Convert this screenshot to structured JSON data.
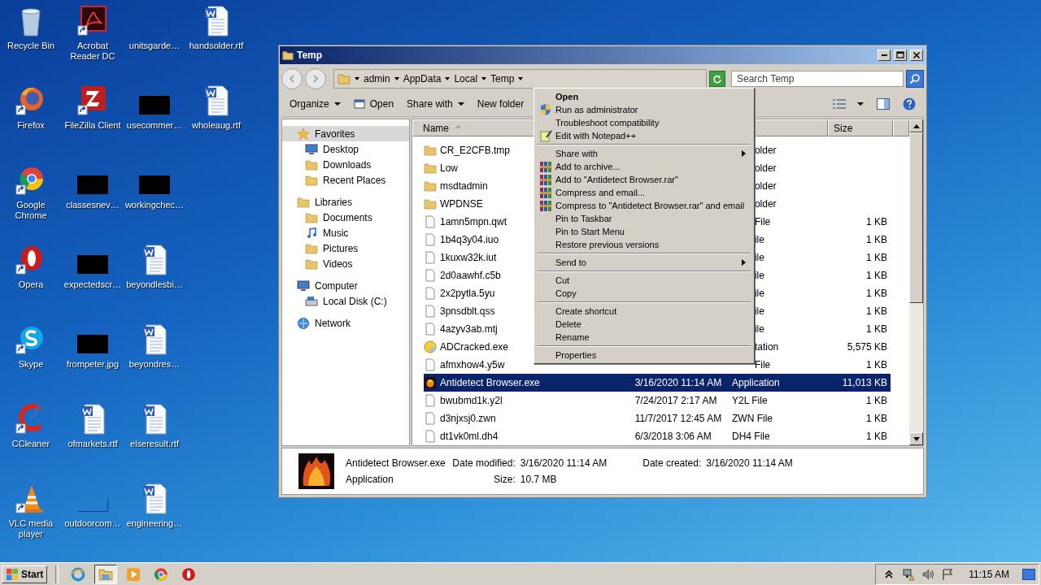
{
  "desktop": {
    "icons": [
      {
        "label": "Recycle Bin",
        "kind": "recycle",
        "shortcut": false
      },
      {
        "label": "Firefox",
        "kind": "firefox",
        "shortcut": true
      },
      {
        "label": "Google Chrome",
        "kind": "chrome",
        "shortcut": true
      },
      {
        "label": "Opera",
        "kind": "opera",
        "shortcut": true
      },
      {
        "label": "Skype",
        "kind": "skype",
        "shortcut": true
      },
      {
        "label": "CCleaner",
        "kind": "ccleaner",
        "shortcut": true
      },
      {
        "label": "VLC media player",
        "kind": "vlc",
        "shortcut": true
      },
      {
        "label": "Acrobat Reader DC",
        "kind": "acrobat",
        "shortcut": true
      },
      {
        "label": "FileZilla Client",
        "kind": "filezilla",
        "shortcut": true
      },
      {
        "label": "classesnev…",
        "kind": "dark",
        "shortcut": false
      },
      {
        "label": "expectedscr…",
        "kind": "dark",
        "shortcut": false
      },
      {
        "label": "frompeter.jpg",
        "kind": "dark",
        "shortcut": false
      },
      {
        "label": "ofmarkets.rtf",
        "kind": "word",
        "shortcut": false
      },
      {
        "label": "outdoorcom…",
        "kind": "blank",
        "shortcut": false
      },
      {
        "label": "unitsgarde…",
        "kind": "blank",
        "shortcut": false
      },
      {
        "label": "usecommer…",
        "kind": "dark",
        "shortcut": false
      },
      {
        "label": "workingchec…",
        "kind": "dark",
        "shortcut": false
      },
      {
        "label": "beyondlesbi…",
        "kind": "word",
        "shortcut": false
      },
      {
        "label": "beyondres…",
        "kind": "word",
        "shortcut": false
      },
      {
        "label": "elseresult.rtf",
        "kind": "word",
        "shortcut": false
      },
      {
        "label": "engineering…",
        "kind": "word",
        "shortcut": false
      },
      {
        "label": "handsolder.rtf",
        "kind": "word",
        "shortcut": false
      },
      {
        "label": "wholeaug.rtf",
        "kind": "word",
        "shortcut": false
      }
    ]
  },
  "window": {
    "title": "Temp",
    "address": [
      "admin",
      "AppData",
      "Local",
      "Temp"
    ],
    "search": {
      "placeholder": "Search Temp"
    },
    "toolbar": [
      {
        "label": "Organize",
        "kind": "text",
        "dropdown": true
      },
      {
        "label": "Open",
        "kind": "open",
        "dropdown": false
      },
      {
        "label": "Share with",
        "kind": "text",
        "dropdown": true
      },
      {
        "label": "New folder",
        "kind": "text",
        "dropdown": false
      }
    ],
    "navigation": [
      {
        "label": "Favorites",
        "kind": "star",
        "selected": true,
        "children": [
          {
            "label": "Desktop",
            "kind": "desktop",
            "selected": false
          },
          {
            "label": "Downloads",
            "kind": "downloads",
            "selected": false
          },
          {
            "label": "Recent Places",
            "kind": "recent",
            "selected": false
          }
        ]
      },
      {
        "label": "Libraries",
        "kind": "library",
        "selected": false,
        "children": [
          {
            "label": "Documents",
            "kind": "documents",
            "selected": false
          },
          {
            "label": "Music",
            "kind": "music",
            "selected": false
          },
          {
            "label": "Pictures",
            "kind": "pictures",
            "selected": false
          },
          {
            "label": "Videos",
            "kind": "videos",
            "selected": false
          }
        ]
      },
      {
        "label": "Computer",
        "kind": "computer",
        "selected": false,
        "children": [
          {
            "label": "Local Disk (C:)",
            "kind": "disk",
            "selected": false
          }
        ]
      },
      {
        "label": "Network",
        "kind": "network",
        "selected": false
      }
    ],
    "columns": [
      {
        "label": "Name",
        "sorted": true
      },
      {
        "label": "Size",
        "sorted": false
      }
    ],
    "rows": [
      {
        "name": "CR_E2CFB.tmp",
        "kind": "folder",
        "type": "older",
        "selected": false
      },
      {
        "name": "Low",
        "kind": "folder",
        "type": "older",
        "selected": false
      },
      {
        "name": "msdtadmin",
        "kind": "folder",
        "type": "older",
        "selected": false
      },
      {
        "name": "WPDNSE",
        "kind": "folder",
        "type": "older",
        "selected": false
      },
      {
        "name": "1amn5mpn.qwt",
        "kind": "file",
        "type": "File",
        "size": "1 KB",
        "selected": false
      },
      {
        "name": "1b4q3y04.iuo",
        "kind": "file",
        "type": "ile",
        "size": "1 KB",
        "selected": false
      },
      {
        "name": "1kuxw32k.iut",
        "kind": "file",
        "type": "ile",
        "size": "1 KB",
        "selected": false
      },
      {
        "name": "2d0aawhf.c5b",
        "kind": "file",
        "type": "ile",
        "size": "1 KB",
        "selected": false
      },
      {
        "name": "2x2pytla.5yu",
        "kind": "file",
        "type": "ile",
        "size": "1 KB",
        "selected": false
      },
      {
        "name": "3pnsdblt.qss",
        "kind": "file",
        "type": "ile",
        "size": "1 KB",
        "selected": false
      },
      {
        "name": "4azyv3ab.mtj",
        "kind": "file",
        "type": "ile",
        "size": "1 KB",
        "selected": false
      },
      {
        "name": "ADCracked.exe",
        "kind": "app-round",
        "type": "tation",
        "size": "5,575 KB",
        "selected": false
      },
      {
        "name": "afmxhow4.y5w",
        "kind": "file",
        "type": "File",
        "size": "1 KB",
        "selected": false
      },
      {
        "name": "Antidetect Browser.exe",
        "kind": "app-fire",
        "date": "3/16/2020 11:14 AM",
        "type": "Application",
        "size": "11,013 KB",
        "selected": true
      },
      {
        "name": "bwubmd1k.y2l",
        "kind": "file",
        "date": "7/24/2017 2:17 AM",
        "type": "Y2L File",
        "size": "1 KB",
        "selected": false
      },
      {
        "name": "d3njxsj0.zwn",
        "kind": "file",
        "date": "11/7/2017 12:45 AM",
        "type": "ZWN File",
        "size": "1 KB",
        "selected": false
      },
      {
        "name": "dt1vk0ml.dh4",
        "kind": "file",
        "date": "6/3/2018 3:06 AM",
        "type": "DH4 File",
        "size": "1 KB",
        "selected": false
      }
    ],
    "details": {
      "name": "Antidetect Browser.exe",
      "type": "Application",
      "fields": [
        {
          "label": "Date modified:",
          "value": "3/16/2020 11:14 AM"
        },
        {
          "label": "Date created:",
          "value": "3/16/2020 11:14 AM"
        },
        {
          "label": "Size:",
          "value": "10.7 MB"
        }
      ]
    }
  },
  "context_menu": {
    "items": [
      {
        "label": "Open",
        "kind": "plain",
        "default": true,
        "submenu": false
      },
      {
        "label": "Run as administrator",
        "kind": "shield",
        "default": false,
        "submenu": false
      },
      {
        "label": "Troubleshoot compatibility",
        "kind": "plain",
        "default": false,
        "submenu": false
      },
      {
        "label": "Edit with Notepad++",
        "kind": "notepad",
        "default": false,
        "submenu": false
      },
      {
        "kind": "separator"
      },
      {
        "label": "Share with",
        "kind": "plain",
        "default": false,
        "submenu": true
      },
      {
        "label": "Add to archive...",
        "kind": "archive",
        "default": false,
        "submenu": false
      },
      {
        "label": "Add to \"Antidetect Browser.rar\"",
        "kind": "archive",
        "default": false,
        "submenu": false
      },
      {
        "label": "Compress and email...",
        "kind": "archive",
        "default": false,
        "submenu": false
      },
      {
        "label": "Compress to \"Antidetect Browser.rar\" and email",
        "kind": "archive",
        "default": false,
        "submenu": false
      },
      {
        "label": "Pin to Taskbar",
        "kind": "plain",
        "default": false,
        "submenu": false
      },
      {
        "label": "Pin to Start Menu",
        "kind": "plain",
        "default": false,
        "submenu": false
      },
      {
        "label": "Restore previous versions",
        "kind": "plain",
        "default": false,
        "submenu": false
      },
      {
        "kind": "separator"
      },
      {
        "label": "Send to",
        "kind": "plain",
        "default": false,
        "submenu": true
      },
      {
        "kind": "separator"
      },
      {
        "label": "Cut",
        "kind": "plain",
        "default": false,
        "submenu": false
      },
      {
        "label": "Copy",
        "kind": "plain",
        "default": false,
        "submenu": false
      },
      {
        "kind": "separator"
      },
      {
        "label": "Create shortcut",
        "kind": "plain",
        "default": false,
        "submenu": false
      },
      {
        "label": "Delete",
        "kind": "plain",
        "default": false,
        "submenu": false
      },
      {
        "label": "Rename",
        "kind": "plain",
        "default": false,
        "submenu": false
      },
      {
        "kind": "separator"
      },
      {
        "label": "Properties",
        "kind": "plain",
        "default": false,
        "submenu": false
      }
    ]
  },
  "taskbar": {
    "start": "Start",
    "apps": [
      {
        "kind": "ie",
        "active": false
      },
      {
        "kind": "explorer",
        "active": true
      },
      {
        "kind": "media",
        "active": false
      },
      {
        "kind": "chrome",
        "active": false
      },
      {
        "kind": "opera",
        "active": false
      }
    ],
    "tray": [
      {
        "kind": "chevron"
      },
      {
        "kind": "network"
      },
      {
        "kind": "volume"
      },
      {
        "kind": "flag"
      }
    ],
    "clock": "11:15 AM"
  }
}
